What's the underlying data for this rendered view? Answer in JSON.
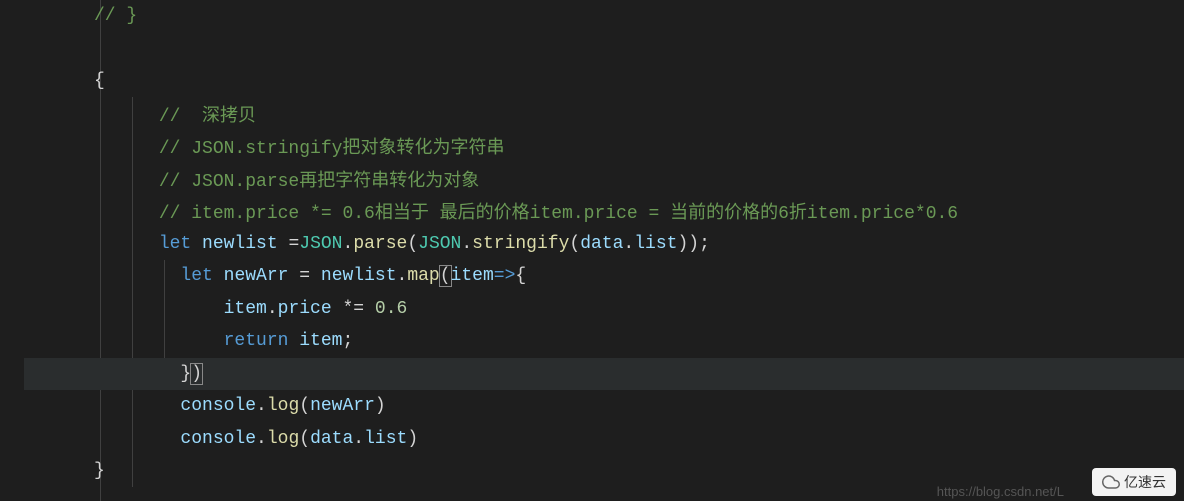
{
  "editor": {
    "theme": "dark",
    "background": "#1e1e1e"
  },
  "code": {
    "lines": [
      {
        "tokens": [
          {
            "t": "comment",
            "v": "// }"
          }
        ],
        "indent": 0
      },
      {
        "tokens": [],
        "indent": 0,
        "blank": true
      },
      {
        "tokens": [
          {
            "t": "punct",
            "v": "{"
          }
        ],
        "indent": 0
      },
      {
        "tokens": [
          {
            "t": "comment",
            "v": "//  深拷贝"
          }
        ],
        "indent": 2
      },
      {
        "tokens": [
          {
            "t": "comment",
            "v": "// JSON.stringify把对象转化为字符串"
          }
        ],
        "indent": 2
      },
      {
        "tokens": [
          {
            "t": "comment",
            "v": "// JSON.parse再把字符串转化为对象"
          }
        ],
        "indent": 2
      },
      {
        "tokens": [
          {
            "t": "comment",
            "v": "// item.price *= 0.6相当于 最后的价格item.price = 当前的价格的6折item.price*0.6"
          }
        ],
        "indent": 2
      },
      {
        "tokens": [
          {
            "t": "keyword",
            "v": "let"
          },
          {
            "t": "space",
            "v": " "
          },
          {
            "t": "variable",
            "v": "newlist"
          },
          {
            "t": "space",
            "v": " "
          },
          {
            "t": "operator",
            "v": "="
          },
          {
            "t": "class-name",
            "v": "JSON"
          },
          {
            "t": "punct",
            "v": "."
          },
          {
            "t": "function-call",
            "v": "parse"
          },
          {
            "t": "paren",
            "v": "("
          },
          {
            "t": "class-name",
            "v": "JSON"
          },
          {
            "t": "punct",
            "v": "."
          },
          {
            "t": "function-call",
            "v": "stringify"
          },
          {
            "t": "paren",
            "v": "("
          },
          {
            "t": "variable",
            "v": "data"
          },
          {
            "t": "punct",
            "v": "."
          },
          {
            "t": "property",
            "v": "list"
          },
          {
            "t": "paren",
            "v": "))"
          },
          {
            "t": "punct",
            "v": ";"
          }
        ],
        "indent": 2
      },
      {
        "tokens": [
          {
            "t": "keyword",
            "v": "let"
          },
          {
            "t": "space",
            "v": " "
          },
          {
            "t": "variable",
            "v": "newArr"
          },
          {
            "t": "space",
            "v": " "
          },
          {
            "t": "operator",
            "v": "="
          },
          {
            "t": "space",
            "v": " "
          },
          {
            "t": "variable",
            "v": "newlist"
          },
          {
            "t": "punct",
            "v": "."
          },
          {
            "t": "function-call",
            "v": "map"
          },
          {
            "t": "paren",
            "v": "(",
            "match": true
          },
          {
            "t": "variable",
            "v": "item"
          },
          {
            "t": "arrow",
            "v": "=>"
          },
          {
            "t": "punct",
            "v": "{"
          }
        ],
        "indent": 3
      },
      {
        "tokens": [
          {
            "t": "variable",
            "v": "item"
          },
          {
            "t": "punct",
            "v": "."
          },
          {
            "t": "property",
            "v": "price"
          },
          {
            "t": "space",
            "v": " "
          },
          {
            "t": "operator",
            "v": "*="
          },
          {
            "t": "space",
            "v": " "
          },
          {
            "t": "number",
            "v": "0.6"
          }
        ],
        "indent": 5
      },
      {
        "tokens": [
          {
            "t": "keyword",
            "v": "return"
          },
          {
            "t": "space",
            "v": " "
          },
          {
            "t": "variable",
            "v": "item"
          },
          {
            "t": "punct",
            "v": ";"
          }
        ],
        "indent": 5
      },
      {
        "tokens": [
          {
            "t": "punct",
            "v": "}"
          },
          {
            "t": "paren",
            "v": ")",
            "match": true
          }
        ],
        "indent": 3,
        "highlighted": true
      },
      {
        "tokens": [
          {
            "t": "variable",
            "v": "console"
          },
          {
            "t": "punct",
            "v": "."
          },
          {
            "t": "function-call",
            "v": "log"
          },
          {
            "t": "paren",
            "v": "("
          },
          {
            "t": "variable",
            "v": "newArr"
          },
          {
            "t": "paren",
            "v": ")"
          }
        ],
        "indent": 3
      },
      {
        "tokens": [
          {
            "t": "variable",
            "v": "console"
          },
          {
            "t": "punct",
            "v": "."
          },
          {
            "t": "function-call",
            "v": "log"
          },
          {
            "t": "paren",
            "v": "("
          },
          {
            "t": "variable",
            "v": "data"
          },
          {
            "t": "punct",
            "v": "."
          },
          {
            "t": "property",
            "v": "list"
          },
          {
            "t": "paren",
            "v": ")"
          }
        ],
        "indent": 3
      },
      {
        "tokens": [
          {
            "t": "punct",
            "v": "}"
          }
        ],
        "indent": 0
      }
    ]
  },
  "watermark": {
    "url": "https://blog.csdn.net/L",
    "logo_text": "亿速云"
  }
}
